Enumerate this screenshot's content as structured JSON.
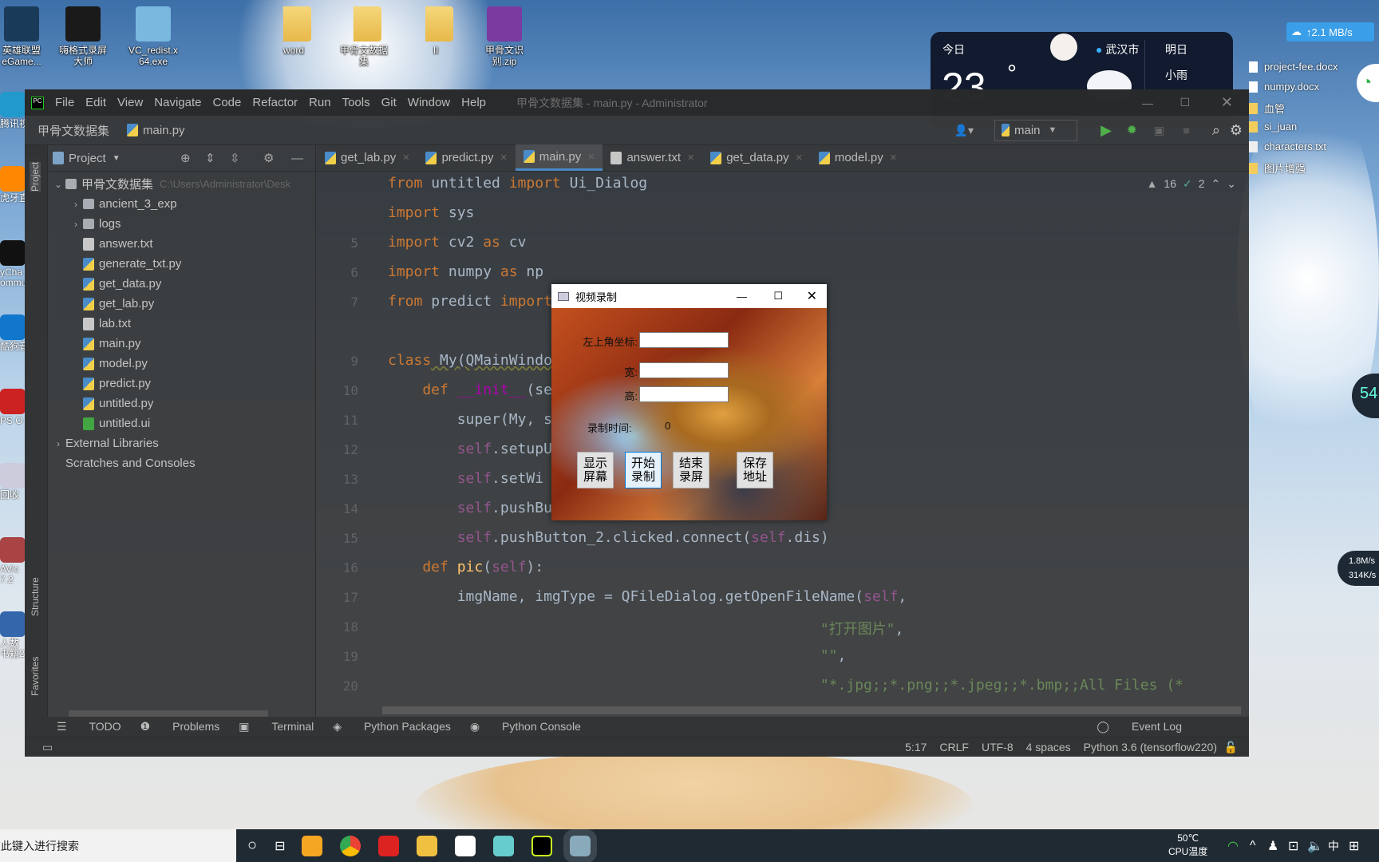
{
  "desktop": {
    "top_icons": [
      {
        "label": "英雄联盟\neGame...",
        "color": "#1a3a5a"
      },
      {
        "label": "嗨格式录屏\n大师",
        "color": "#1a1a1a"
      },
      {
        "label": "VC_redist.x\n64.exe",
        "color": "#7ab8e0"
      },
      {
        "label": "word",
        "color": "folder"
      },
      {
        "label": "甲骨文数据\n集",
        "color": "folder"
      },
      {
        "label": "II",
        "color": "folder"
      },
      {
        "label": "甲骨文识\n别.zip",
        "color": "#7a3aa0"
      }
    ],
    "left_icons": [
      "腾讯视",
      "虎牙直",
      "yCha\nommu",
      "酷狗音",
      "PS O",
      "回收",
      "AVic\n7.2",
      "人数\n书籍2"
    ],
    "right_files": [
      {
        "label": "project-fee.docx",
        "icon": "word-doc-icon"
      },
      {
        "label": "numpy.docx",
        "icon": "word-doc-icon"
      },
      {
        "label": "血管",
        "icon": "folder-icon"
      },
      {
        "label": "si_juan",
        "icon": "folder-icon"
      },
      {
        "label": "characters.txt",
        "icon": "text-file-icon"
      },
      {
        "label": "图片增强",
        "icon": "folder-icon"
      }
    ],
    "net_speed": "↑2.1 MB/s",
    "side_widget": {
      "value": "54",
      "up": "1.8M/s",
      "down": "314K/s"
    }
  },
  "weather": {
    "today": "今日",
    "city": "武汉市",
    "tomorrow": "明日",
    "temp": "23",
    "degree": "°",
    "condition": "小雨"
  },
  "ide": {
    "title": "甲骨文数据集 - main.py - Administrator",
    "menu": [
      "File",
      "Edit",
      "View",
      "Navigate",
      "Code",
      "Refactor",
      "Run",
      "Tools",
      "Git",
      "Window",
      "Help"
    ],
    "breadcrumb": [
      "甲骨文数据集",
      "main.py"
    ],
    "run_config": "main",
    "project_label": "Project",
    "stripe_labels": [
      "Project",
      "Structure",
      "Favorites"
    ],
    "tree": {
      "root": "甲骨文数据集",
      "root_path": "C:\\Users\\Administrator\\Desk",
      "items": [
        {
          "label": "ancient_3_exp",
          "type": "dir"
        },
        {
          "label": "logs",
          "type": "dir"
        },
        {
          "label": "answer.txt",
          "type": "txt"
        },
        {
          "label": "generate_txt.py",
          "type": "py"
        },
        {
          "label": "get_data.py",
          "type": "py"
        },
        {
          "label": "get_lab.py",
          "type": "py"
        },
        {
          "label": "lab.txt",
          "type": "txt"
        },
        {
          "label": "main.py",
          "type": "py"
        },
        {
          "label": "model.py",
          "type": "py"
        },
        {
          "label": "predict.py",
          "type": "py"
        },
        {
          "label": "untitled.py",
          "type": "py"
        },
        {
          "label": "untitled.ui",
          "type": "ui"
        }
      ],
      "external": "External Libraries",
      "scratches": "Scratches and Consoles"
    },
    "tabs": [
      {
        "label": "get_lab.py"
      },
      {
        "label": "predict.py"
      },
      {
        "label": "main.py",
        "active": true
      },
      {
        "label": "answer.txt"
      },
      {
        "label": "get_data.py"
      },
      {
        "label": "model.py"
      }
    ],
    "inspections": {
      "warnings": "16",
      "typos": "2"
    },
    "code": [
      {
        "n": "",
        "t": [
          [
            "from",
            "kw"
          ],
          [
            " untitled ",
            ""
          ],
          [
            "import",
            "kw"
          ],
          [
            " Ui_Dialog",
            ""
          ]
        ]
      },
      {
        "n": "",
        "t": [
          [
            "import",
            "kw"
          ],
          [
            " sys",
            ""
          ]
        ]
      },
      {
        "n": "5",
        "t": [
          [
            "import",
            "kw"
          ],
          [
            " cv2 ",
            ""
          ],
          [
            "as",
            "kw"
          ],
          [
            " cv",
            ""
          ]
        ]
      },
      {
        "n": "6",
        "t": [
          [
            "import",
            "kw"
          ],
          [
            " numpy ",
            ""
          ],
          [
            "as",
            "kw"
          ],
          [
            " np",
            ""
          ]
        ]
      },
      {
        "n": "7",
        "t": [
          [
            "from",
            "kw"
          ],
          [
            " predict ",
            ""
          ],
          [
            "import",
            "kw"
          ]
        ]
      },
      {
        "n": "",
        "t": []
      },
      {
        "n": "9",
        "t": [
          [
            "class",
            "kw"
          ],
          [
            " My(QMainWindo",
            "un"
          ]
        ]
      },
      {
        "n": "10",
        "t": [
          [
            "    def ",
            "kw"
          ],
          [
            "__init__",
            "mg"
          ],
          [
            "(se",
            ""
          ]
        ]
      },
      {
        "n": "11",
        "t": [
          [
            "        super",
            ""
          ],
          [
            "(My, se",
            ""
          ]
        ]
      },
      {
        "n": "12",
        "t": [
          [
            "        self",
            "sf"
          ],
          [
            ".setupU",
            ""
          ]
        ]
      },
      {
        "n": "13",
        "t": [
          [
            "        self",
            "sf"
          ],
          [
            ".setWi",
            ""
          ]
        ]
      },
      {
        "n": "14",
        "t": [
          [
            "        self",
            "sf"
          ],
          [
            ".pushBu",
            ""
          ]
        ]
      },
      {
        "n": "15",
        "t": [
          [
            "        self",
            "sf"
          ],
          [
            ".pushButton_2.clicked.connect(",
            ""
          ],
          [
            "self",
            "sf"
          ],
          [
            ".dis)",
            ""
          ]
        ]
      },
      {
        "n": "16",
        "t": [
          [
            "    def ",
            "kw"
          ],
          [
            "pic",
            "fn"
          ],
          [
            "(",
            ""
          ],
          [
            "self",
            "sf"
          ],
          [
            "):",
            ""
          ]
        ]
      },
      {
        "n": "17",
        "t": [
          [
            "        imgName",
            ""
          ],
          [
            ", ",
            ""
          ],
          [
            "imgType",
            ""
          ],
          [
            " = QFileDialog.getOpenFileName(",
            ""
          ],
          [
            "self",
            "sf"
          ],
          [
            ",",
            ""
          ]
        ]
      },
      {
        "n": "18",
        "t": [
          [
            "                                                  \"打开图片\"",
            "st"
          ],
          [
            ",",
            ""
          ]
        ]
      },
      {
        "n": "19",
        "t": [
          [
            "                                                  \"\"",
            "st"
          ],
          [
            ",",
            ""
          ]
        ]
      },
      {
        "n": "20",
        "t": [
          [
            "                                                  \"*.jpg;;*.png;;*.jpeg;;*.bmp;;All Files (*",
            "st"
          ]
        ]
      }
    ],
    "bottom_tools": [
      "TODO",
      "Problems",
      "Terminal",
      "Python Packages",
      "Python Console"
    ],
    "event_log": "Event Log",
    "status": [
      "5:17",
      "CRLF",
      "UTF-8",
      "4 spaces",
      "Python 3.6 (tensorflow220)"
    ]
  },
  "dialog": {
    "title": "视频录制",
    "labels": {
      "top_left": "左上角坐标:",
      "width": "宽:",
      "height": "高:",
      "time": "录制时间:"
    },
    "time_value": "0",
    "inputs": {
      "top_left": "",
      "width": "",
      "height": ""
    },
    "buttons": [
      "显示\n屏幕",
      "开始\n录制",
      "结束\n录屏",
      "保存\n地址"
    ]
  },
  "taskbar": {
    "search_placeholder": "在此键入进行搜索",
    "cpu_temp": "50℃",
    "cpu_label": "CPU温度",
    "ime": "中"
  },
  "colors": {
    "accent": "#4a88c7",
    "keyword": "#cc7832",
    "self": "#94558d",
    "string": "#6a8759"
  }
}
